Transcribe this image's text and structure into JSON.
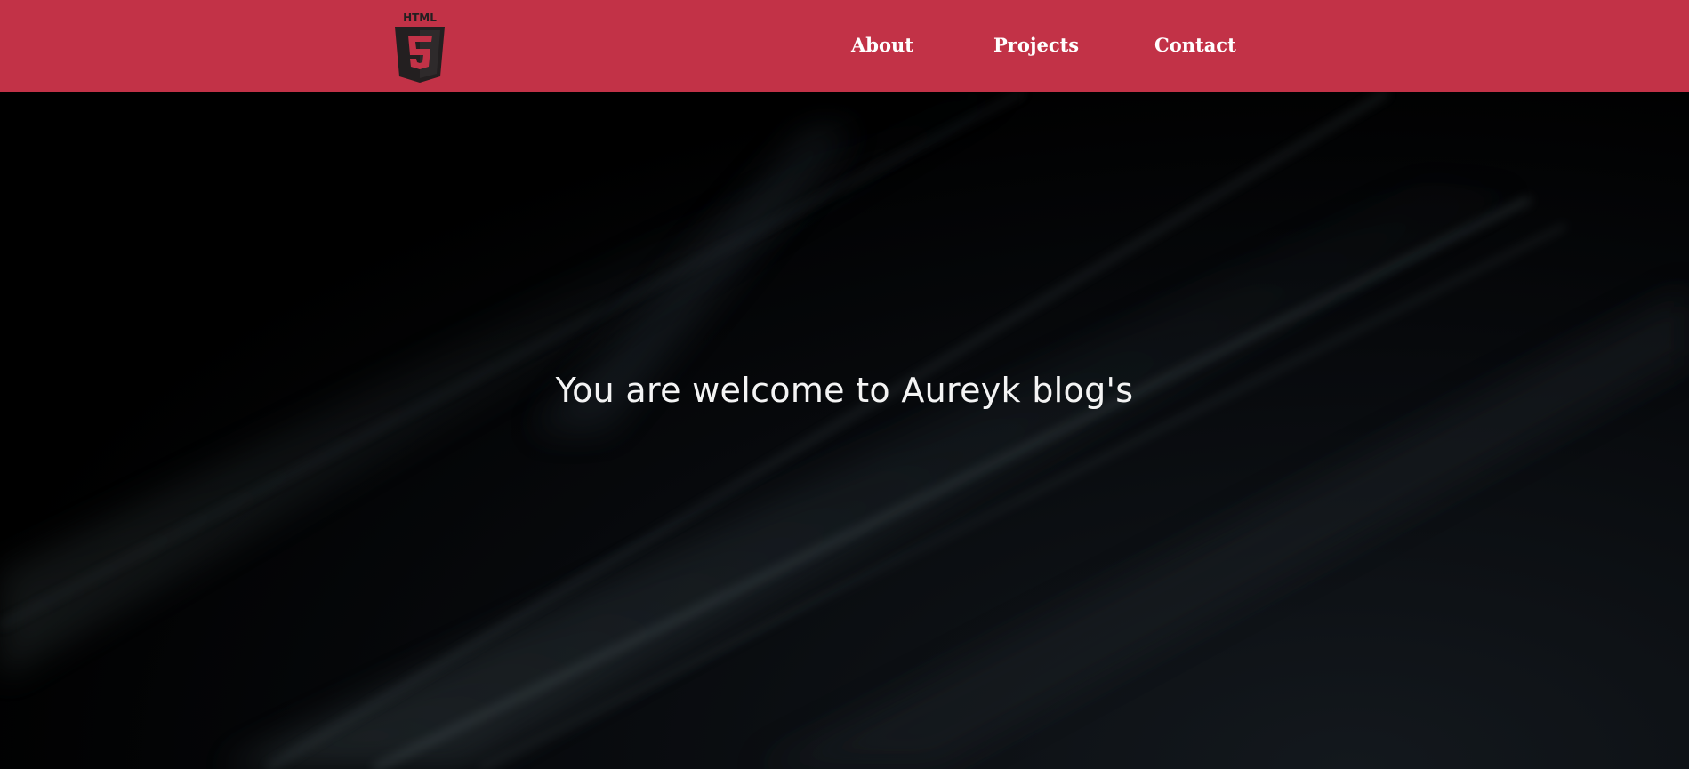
{
  "header": {
    "logo": {
      "icon": "html5-logo-icon",
      "text": "HTML",
      "numeral": "5"
    },
    "nav": [
      {
        "label": "About"
      },
      {
        "label": "Projects"
      },
      {
        "label": "Contact"
      }
    ]
  },
  "hero": {
    "title": "You are welcome to Aureyk blog's"
  },
  "colors": {
    "navbar_bg": "#c23247",
    "logo_fill": "#231f20",
    "hero_bg": "#000000",
    "text_light": "#ffffff"
  }
}
